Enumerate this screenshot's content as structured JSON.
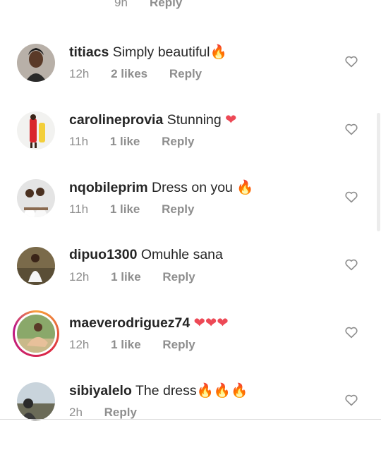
{
  "top": {
    "time": "9h",
    "reply": "Reply"
  },
  "comments": [
    {
      "username": "titiacs",
      "text": "Simply beautiful",
      "emoji": "🔥",
      "time": "12h",
      "likes": "2 likes",
      "reply": "Reply"
    },
    {
      "username": "carolineprovia",
      "text": "Stunning",
      "emoji": "❤",
      "time": "11h",
      "likes": "1 like",
      "reply": "Reply"
    },
    {
      "username": "nqobileprim",
      "text": "Dress on you",
      "emoji": "🔥",
      "time": "11h",
      "likes": "1 like",
      "reply": "Reply"
    },
    {
      "username": "dipuo1300",
      "text": "Omuhle sana",
      "emoji": "",
      "time": "12h",
      "likes": "1 like",
      "reply": "Reply"
    },
    {
      "username": "maeverodriguez74",
      "text": "",
      "emoji": "❤❤❤",
      "time": "12h",
      "likes": "1 like",
      "reply": "Reply"
    },
    {
      "username": "sibiyalelo",
      "text": "The dress",
      "emoji": "🔥🔥🔥",
      "time": "2h",
      "likes": "",
      "reply": "Reply"
    }
  ],
  "colors": {
    "muted": "#8e8e8e",
    "text": "#262626",
    "heart_red": "#ed4956",
    "fire": "#f77f00"
  },
  "icons": {
    "like": "heart-outline-icon"
  }
}
